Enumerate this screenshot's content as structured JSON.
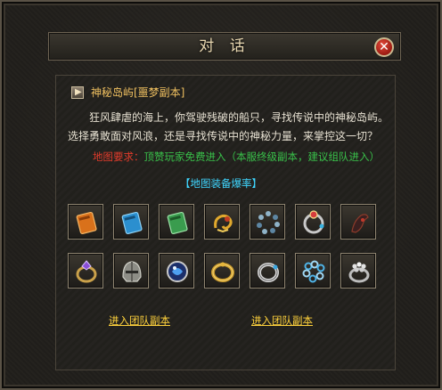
{
  "dialog": {
    "title": "对 话",
    "close_icon": "close-icon",
    "map_name": "神秘岛屿[噩梦副本]",
    "description_line1": "狂风肆虐的海上，你驾驶残破的船只，寻找传说中的神秘岛屿。",
    "description_line2": "选择勇敢面对风浪，还是寻找传说中的神秘力量，来掌控这一切？",
    "requirement_label": "地图要求：",
    "requirement_value": "顶赞玩家免费进入（本服终级副本，建议组队进入）",
    "drop_title": "【地图装备爆率】",
    "items": [
      {
        "name": "orange-book-icon"
      },
      {
        "name": "blue-book-icon"
      },
      {
        "name": "green-book-icon"
      },
      {
        "name": "gold-dragon-ornament-icon"
      },
      {
        "name": "bead-bracelet-icon"
      },
      {
        "name": "jeweled-ring-icon"
      },
      {
        "name": "dark-claw-icon"
      },
      {
        "name": "purple-gem-ring-icon"
      },
      {
        "name": "helmet-icon"
      },
      {
        "name": "blue-orb-icon"
      },
      {
        "name": "gold-bracelet-icon"
      },
      {
        "name": "silver-ring-icon"
      },
      {
        "name": "blue-chain-bracelet-icon"
      },
      {
        "name": "silver-beaded-ring-icon"
      }
    ],
    "link_left": "进入团队副本",
    "link_right": "进入团队副本"
  },
  "colors": {
    "map_name": "#f0c060",
    "requirement_label": "#e03b2b",
    "requirement_value": "#39c14a",
    "drop_title": "#3fd6ff",
    "link": "#ffd23c"
  }
}
